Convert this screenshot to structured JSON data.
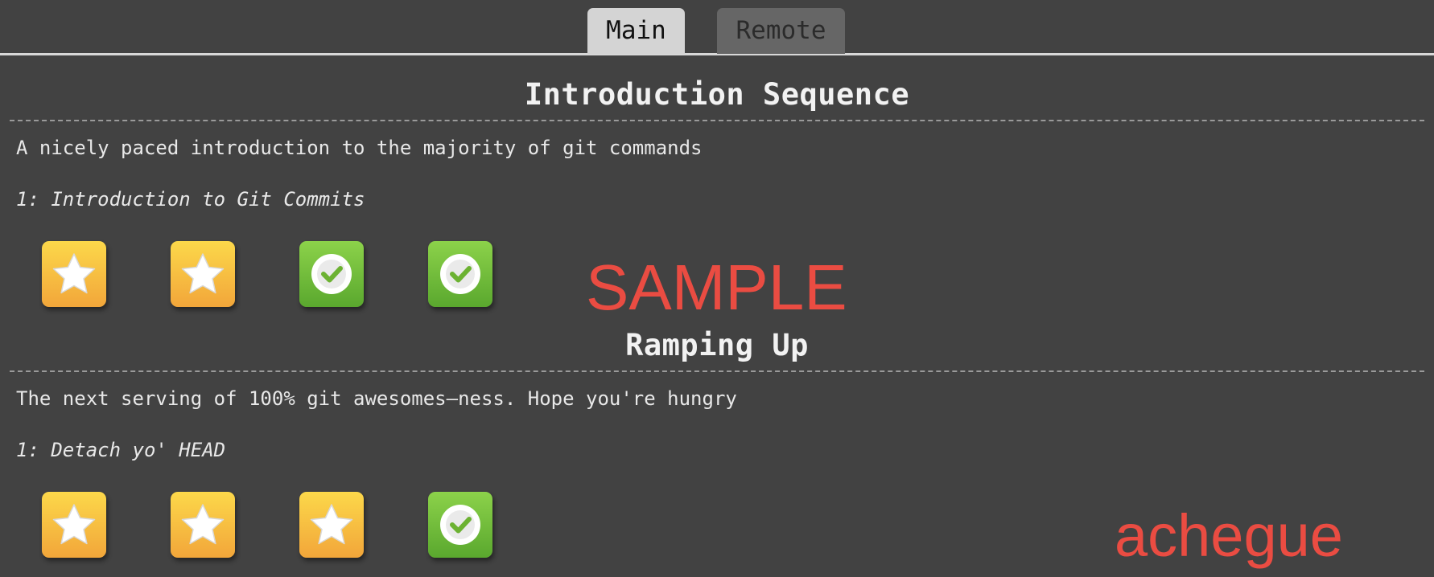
{
  "tabs": {
    "main": "Main",
    "remote": "Remote"
  },
  "sections": [
    {
      "title": "Introduction Sequence",
      "description": "A nicely paced introduction to the majority of git commands",
      "level": "1: Introduction to Git Commits",
      "icons": [
        "star-icon",
        "star-icon",
        "check-icon",
        "check-icon"
      ]
    },
    {
      "title": "Ramping Up",
      "description": "The next serving of 100% git awesomes—ness. Hope you're hungry",
      "level": "1: Detach yo' HEAD",
      "icons": [
        "star-icon",
        "star-icon",
        "star-icon",
        "check-icon"
      ]
    }
  ],
  "watermarks": [
    "SAMPLE",
    "achegue"
  ],
  "colors": {
    "background": "#424242",
    "star_tile": "#f6b93e",
    "check_tile": "#74bd3c",
    "watermark": "#ea4c42"
  }
}
